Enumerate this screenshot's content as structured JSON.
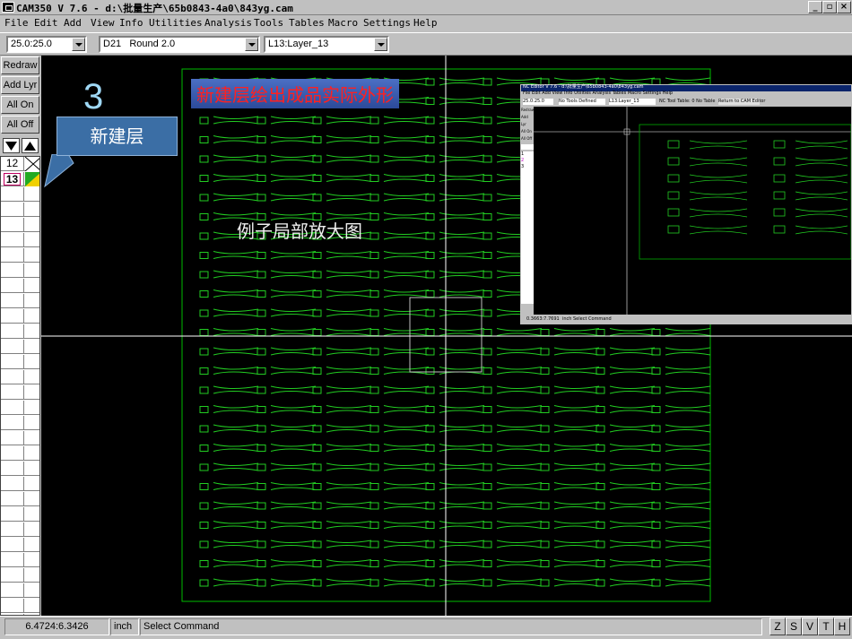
{
  "window": {
    "title": "CAM350 V 7.6 - d:\\批量生产\\65b0843-4a0\\843yg.cam",
    "buttons": {
      "minimize": "_",
      "restore": "▫",
      "close": "×"
    }
  },
  "menu": {
    "items": [
      "File",
      "Edit",
      "Add",
      "View",
      "Info",
      "Utilities",
      "Analysis",
      "Tools",
      "Tables",
      "Macro",
      "Settings",
      "Help"
    ]
  },
  "toolbar": {
    "grid_value": "25.0:25.0",
    "aperture_value": "D21   Round 2.0",
    "layer_value": "L13:Layer_13"
  },
  "left_panel": {
    "redraw": "Redraw",
    "add_layer": "Add Lyr",
    "all_on": "All On",
    "all_off": "All Off",
    "layers": [
      {
        "number": "12",
        "color": "#000000"
      },
      {
        "number": "13",
        "color": "#22aa22"
      }
    ]
  },
  "annotations": {
    "step_number": "3",
    "callout": "新建层",
    "banner": "新建层绘出成品实际外形",
    "zoom_note": "例子局部放大图"
  },
  "inset": {
    "title": "NC Editor V 7.6 - d:\\批量生产\\65b0843-4a0\\843yg.cam",
    "menu": [
      "File",
      "Edit",
      "Add",
      "View",
      "Info",
      "Utilities",
      "Analysis",
      "Tables",
      "Macro",
      "Settings",
      "Help"
    ],
    "toolbar": [
      "25.0:25.0",
      "No Tools Defined",
      "L13:Layer_13",
      "NC Tool Table: 0  No Table",
      "Return to CAM Editor"
    ],
    "left_buttons": [
      "Redraw",
      "Add Lyr",
      "All On",
      "All Off"
    ],
    "layers": [
      "1",
      "2",
      "3"
    ],
    "coords": "0.3663:7.7691",
    "units": "inch",
    "command": "Select Command"
  },
  "status": {
    "coordinates": "6.4724:6.3426",
    "units": "inch",
    "command": "Select Command",
    "mode_buttons": [
      "Z",
      "S",
      "V",
      "T",
      "H"
    ]
  },
  "colors": {
    "canvas_bg": "#000000",
    "board_outline": "#00bb00",
    "part_outline": "#22cc22",
    "crosshair": "#ffffff"
  }
}
